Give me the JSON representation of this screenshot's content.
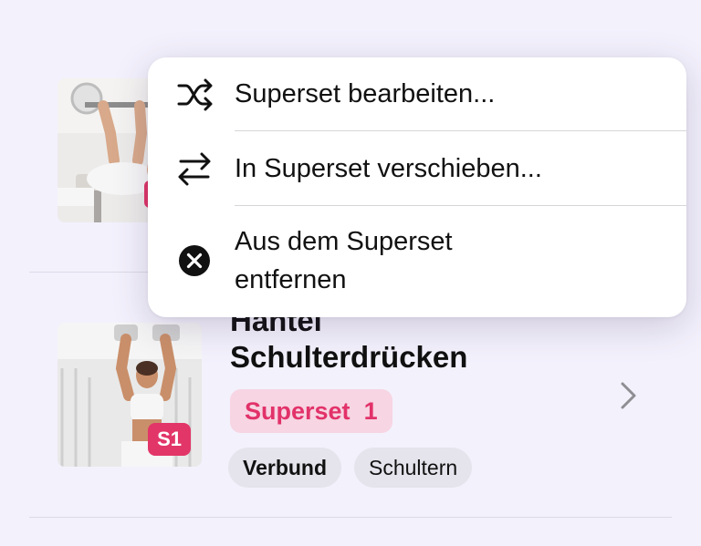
{
  "menu": {
    "items": [
      {
        "label": "Superset bearbeiten...",
        "icon": "shuffle-icon"
      },
      {
        "label": "In Superset verschieben...",
        "icon": "arrows-left-right-icon"
      },
      {
        "label": "Aus dem Superset entfernen",
        "icon": "xmark-circle-icon"
      }
    ]
  },
  "exercises": [
    {
      "title": "",
      "thumbnail": "bench-press-image"
    },
    {
      "title_line1": "Hantel",
      "title_line2": "Schulterdrücken",
      "superset_badge": "S1",
      "superset_label": "Superset",
      "superset_number": "1",
      "tags": [
        "Verbund",
        "Schultern"
      ],
      "thumbnail": "shoulder-press-image"
    }
  ],
  "colors": {
    "background": "#f3f1fc",
    "accent": "#e2326a",
    "superset_pill_bg": "#f7d5e2",
    "tag_bg": "#e5e4ec"
  }
}
